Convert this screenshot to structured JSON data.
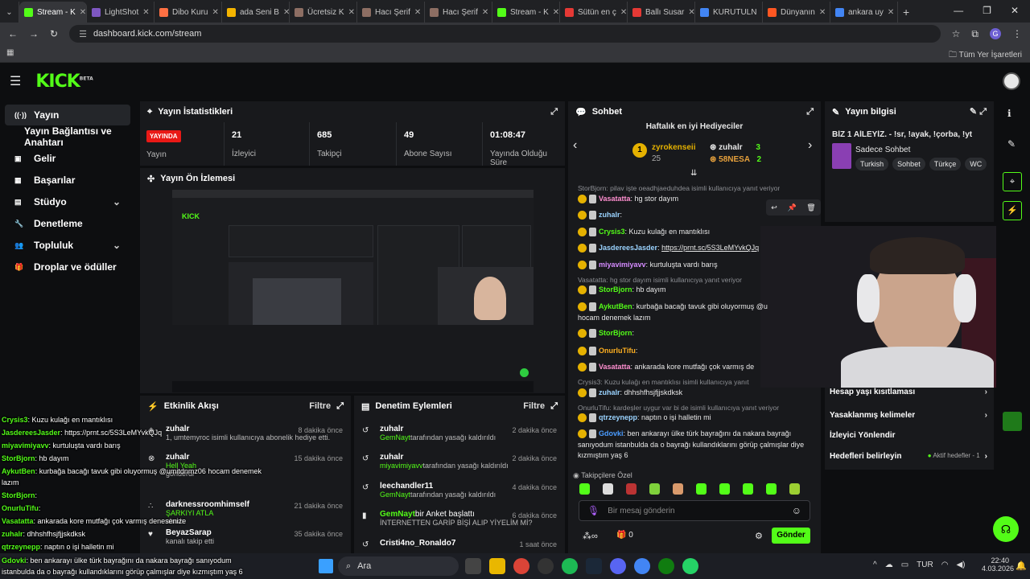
{
  "browser": {
    "tabs": [
      {
        "label": "Stream - K",
        "color": "#53fc18"
      },
      {
        "label": "LightShot",
        "color": "#7e57c2"
      },
      {
        "label": "Dibo Kuru",
        "color": "#ff7043"
      },
      {
        "label": "ada Seni B",
        "color": "#f4b400"
      },
      {
        "label": "Ücretsiz K",
        "color": "#8d6e63"
      },
      {
        "label": "Hacı Şerif",
        "color": "#8d6e63"
      },
      {
        "label": "Hacı Şerif",
        "color": "#8d6e63"
      },
      {
        "label": "Stream - K",
        "color": "#53fc18"
      },
      {
        "label": "Sütün en ç",
        "color": "#e53935"
      },
      {
        "label": "Ballı Susar",
        "color": "#e53935"
      },
      {
        "label": "KURUTULN",
        "color": "#4285f4"
      },
      {
        "label": "Dünyanın",
        "color": "#ff5722"
      },
      {
        "label": "ankara uy",
        "color": "#4285f4"
      }
    ],
    "new_tab": "+",
    "url": "dashboard.kick.com/stream",
    "bookmarks_label": "Tüm Yer İşaretleri",
    "profile": "G"
  },
  "header": {
    "logo": "KICK",
    "logo_sup": "BETA"
  },
  "sidebar": {
    "items": [
      {
        "label": "Yayın",
        "icon": "broadcast-icon"
      },
      {
        "label": "Yayın Bağlantısı ve Anahtarı"
      },
      {
        "label": "Gelir",
        "icon": "revenue-icon"
      },
      {
        "label": "Başarılar",
        "icon": "achievements-icon"
      },
      {
        "label": "Stüdyo",
        "icon": "studio-icon"
      },
      {
        "label": "Denetleme",
        "icon": "wrench-icon"
      },
      {
        "label": "Topluluk",
        "icon": "community-icon"
      },
      {
        "label": "Droplar ve ödüller",
        "icon": "gift-icon"
      }
    ]
  },
  "stats": {
    "title": "Yayın İstatistikleri",
    "live_badge": "YAYINDA",
    "live_label": "Yayın",
    "viewers": {
      "value": "21",
      "label": "İzleyici"
    },
    "followers": {
      "value": "685",
      "label": "Takipçi"
    },
    "subs": {
      "value": "49",
      "label": "Abone Sayısı"
    },
    "uptime": {
      "value": "01:08:47",
      "label": "Yayında Olduğu Süre"
    }
  },
  "preview": {
    "title": "Yayın Ön İzlemesi"
  },
  "activity": {
    "title": "Etkinlik Akışı",
    "filter": "Filtre",
    "events": [
      {
        "user": "zuhalr",
        "text": "1, umtemyroc isimli kullanıcıya abonelik hediye etti.",
        "time": "8 dakika önce"
      },
      {
        "user": "zuhalr",
        "text": "Hell Yeah",
        "sub": "gönderdi",
        "time": "15 dakika önce"
      },
      {
        "user": "darknessroomhimself",
        "text": "ŞARKIYI ATLA",
        "sub": "alındı",
        "time": "21 dakika önce"
      },
      {
        "user": "BeyazSarap",
        "text": "kanalı takip etti",
        "time": "35 dakika önce"
      }
    ]
  },
  "moderation": {
    "title": "Denetim Eylemleri",
    "filter": "Filtre",
    "events": [
      {
        "user": "zuhalr",
        "actor": "GemNayt",
        "text": "tarafından yasağı kaldırıldı",
        "time": "2 dakika önce"
      },
      {
        "user": "zuhalr",
        "actor": "miyavimiyavv",
        "text": "tarafından yasağı kaldırıldı",
        "time": "2 dakika önce"
      },
      {
        "user": "leechandler11",
        "actor": "GemNayt",
        "text": "tarafından yasağı kaldırıldı",
        "time": "4 dakika önce"
      },
      {
        "user": "GemNayt",
        "text": "bir Anket başlattı",
        "sub": "İNTERNETTEN GARİP BİŞİ ALIP YİYELİM Mİ?",
        "time": "6 dakika önce"
      },
      {
        "user": "Cristi4no_Ronaldo7",
        "text": "",
        "time": "1 saat önce"
      }
    ]
  },
  "chat": {
    "title": "Sohbet",
    "gifters_title": "Haftalık en iyi Hediyeciler",
    "gifters": [
      {
        "rank": "1",
        "name": "zyrokenseii",
        "count": "25"
      },
      {
        "name": "zuhalr",
        "count": "3"
      },
      {
        "name": "58NESA",
        "count": "2"
      }
    ],
    "messages": [
      {
        "reply": "StorBjorn: pilav işte oeadhjaeduhdea isimli kullanıcıya yanıt veriyor"
      },
      {
        "user": "Vasatatta",
        "color": "#ff8fd0",
        "text": "hg stor dayım"
      },
      {
        "user": "zuhalr",
        "color": "#9ad3ff",
        "text": ""
      },
      {
        "user": "Crysis3",
        "color": "#53fc18",
        "text": "Kuzu kulağı en mantıklısı"
      },
      {
        "user": "JasdereesJasder",
        "color": "#9ad3ff",
        "text": "https://prnt.sc/5S3LeMYvkQJq"
      },
      {
        "user": "miyavimiyavv",
        "color": "#d58bff",
        "text": "kurtuluşta vardı barış"
      },
      {
        "reply": "Vasatatta: hg stor dayım isimli kullanıcıya yanıt veriyor"
      },
      {
        "user": "StorBjorn",
        "color": "#53fc18",
        "text": "hb dayım"
      },
      {
        "user": "AykutBen",
        "color": "#53fc18",
        "text": "kurbağa bacağı tavuk gibi oluyormuş @u"
      },
      {
        "text": "hocam denemek lazım"
      },
      {
        "user": "StorBjorn",
        "color": "#53fc18",
        "text": ""
      },
      {
        "user": "OnurluTifu",
        "color": "#ffb020",
        "text": ""
      },
      {
        "user": "Vasatatta",
        "color": "#ff8fd0",
        "text": "ankarada kore mutfağı çok varmış de"
      },
      {
        "reply": "Crysis3: Kuzu kulağı en mantıklısı isimli kullanıcıya yanıt"
      },
      {
        "user": "zuhalr",
        "color": "#9ad3ff",
        "text": "dhhshfhsjfjjskdksk"
      },
      {
        "reply": "OnurluTifu: kardeşler uygur var bi de isimli kullanıcıya yanıt veriyor"
      },
      {
        "user": "qtrzeynepp",
        "color": "#9ad3ff",
        "text": "naptın o işi halletin mi"
      },
      {
        "user": "Gdovki",
        "color": "#4a9cff",
        "text": "ben ankarayı ülke türk bayrağını da nakara bayrağı"
      },
      {
        "text": "sanıyodum istanbulda da o bayrağı kullandıklarını görüp çalmışlar diye"
      },
      {
        "text": "kızmıştım yaş 6"
      }
    ],
    "followers_only": "Takipçilere Özel",
    "input_placeholder": "Bir mesaj gönderin",
    "points": "0",
    "send": "Gönder"
  },
  "stream_info": {
    "title": "Yayın bilgisi",
    "stream_title": "BİZ 1 AİLEYİZ. - !sr, !ayak, !çorba, !yt",
    "category": "Sadece Sohbet",
    "tags": [
      "Turkish",
      "Sohbet",
      "Türkçe",
      "WC"
    ]
  },
  "settings_menu": [
    {
      "label": "Hesap yaşı kısıtlaması"
    },
    {
      "label": "Yasaklanmış kelimeler"
    },
    {
      "label": "İzleyici Yönlendir"
    },
    {
      "label": "Hedefleri belirleyin",
      "status": "Aktif hedefler - 1"
    }
  ],
  "overlay_chat": [
    {
      "user": "Crysis3",
      "text": ": Kuzu kulağı en mantıklısı"
    },
    {
      "user": "JasdereesJasder",
      "text": ": https://prnt.sc/5S3LeMYvkQJq"
    },
    {
      "user": "miyavimiyavv",
      "text": ": kurtuluşta vardı barış"
    },
    {
      "user": "StorBjorn",
      "text": ": hb dayım"
    },
    {
      "user": "AykutBen",
      "text": ": kurbağa bacağı tavuk gibi oluyormuş @umitdnmz06 hocam denemek"
    },
    {
      "user": "",
      "text": "lazım"
    },
    {
      "user": "StorBjorn",
      "text": ":"
    },
    {
      "user": "OnurluTifu",
      "text": ":"
    },
    {
      "user": "Vasatatta",
      "text": ": ankarada kore mutfağı çok varmış denesenize"
    },
    {
      "user": "zuhalr",
      "text": ": dhhshfhsjfjjskdksk"
    },
    {
      "user": "qtrzeynepp",
      "text": ": naptın o işi halletin mi"
    },
    {
      "user": "Gdovki",
      "text": ": ben ankarayı ülke türk bayrağını da nakara bayrağı sanıyodum"
    },
    {
      "user": "",
      "text": "istanbulda da o bayrağı kullandıklarını görüp çalmışlar diye kızmıştım yaş 6"
    }
  ],
  "taskbar": {
    "search": "Ara",
    "lang": "TUR",
    "time": "22:40",
    "date": "4.03.2026"
  }
}
